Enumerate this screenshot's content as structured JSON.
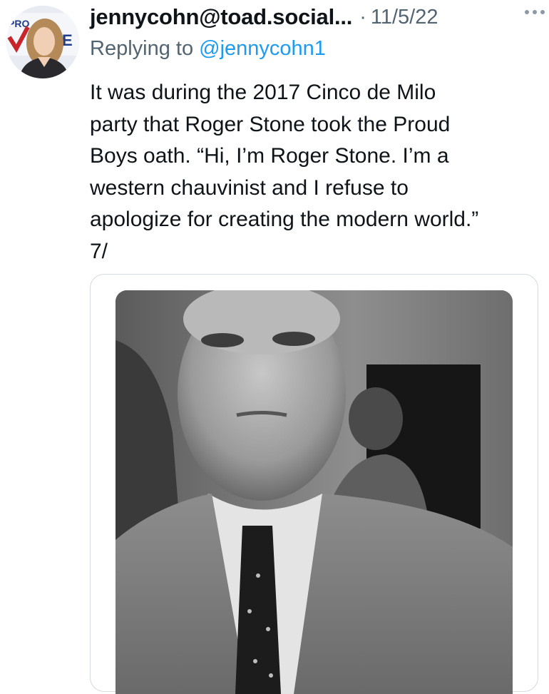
{
  "tweet": {
    "author": {
      "display_name": "jennycohn@toad.social...",
      "avatar_text": "PRO VOTE"
    },
    "separator": "·",
    "timestamp": "11/5/22",
    "reply": {
      "prefix": "Replying to ",
      "handle": "@jennycohn1"
    },
    "text_lines": [
      "It was during the 2017 Cinco de Milo",
      "party that Roger Stone took the Proud",
      "Boys oath. “Hi, I’m Roger Stone. I’m a",
      "western chauvinist and I refuse to",
      "apologize for creating the modern world.”",
      "7/"
    ],
    "more_icon": "more-horizontal-icon",
    "media": {
      "kind": "photo",
      "description_icon": "video-still"
    }
  }
}
